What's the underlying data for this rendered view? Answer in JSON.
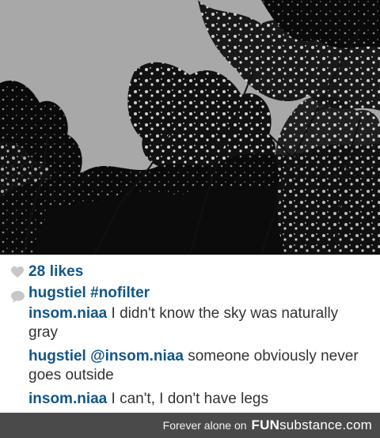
{
  "post": {
    "likes_text": "28 likes",
    "caption": {
      "user": "hugstiel",
      "hashtag": "#nofilter"
    },
    "comments": [
      {
        "user": "insom.niaa",
        "text": "I didn't know the sky was naturally gray"
      },
      {
        "user": "hugstiel",
        "mention": "@insom.niaa",
        "text": "someone obviously never goes outside"
      },
      {
        "user": "insom.niaa",
        "text": "I can't, I don't have legs"
      }
    ]
  },
  "footer": {
    "tagline": "Forever alone on",
    "brand_strong": "FUN",
    "brand_rest": "substance.com"
  },
  "colors": {
    "username": "#125688",
    "body_text": "#333333",
    "footer_bg": "#4a4a4a"
  },
  "icons": {
    "likes": "heart-icon",
    "caption": "speech-bubble-icon"
  }
}
